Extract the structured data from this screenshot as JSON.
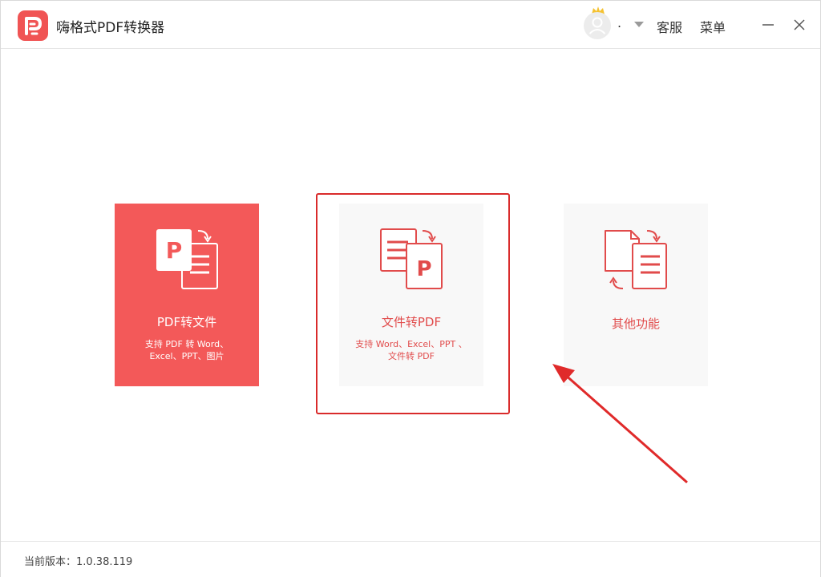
{
  "app": {
    "title": "嗨格式PDF转换器",
    "accent_color": "#f35959",
    "logo_icon": "pdf-logo-icon"
  },
  "header": {
    "user_name": ".",
    "support_label": "客服",
    "menu_label": "菜单",
    "minimize_icon": "minimize-icon",
    "close_icon": "close-icon"
  },
  "cards": [
    {
      "title": "PDF转文件",
      "description_line1": "支持 PDF 转 Word、",
      "description_line2": "Excel、PPT、图片",
      "icon": "pdf-to-file-icon",
      "selected": true
    },
    {
      "title": "文件转PDF",
      "description_line1": "支持 Word、Excel、PPT 、",
      "description_line2": "文件转 PDF",
      "icon": "file-to-pdf-icon",
      "highlighted": true
    },
    {
      "title": "其他功能",
      "icon": "other-tools-icon"
    }
  ],
  "footer": {
    "version": "当前版本：1.0.38.119"
  },
  "annotation": {
    "color": "#d92b2b"
  }
}
